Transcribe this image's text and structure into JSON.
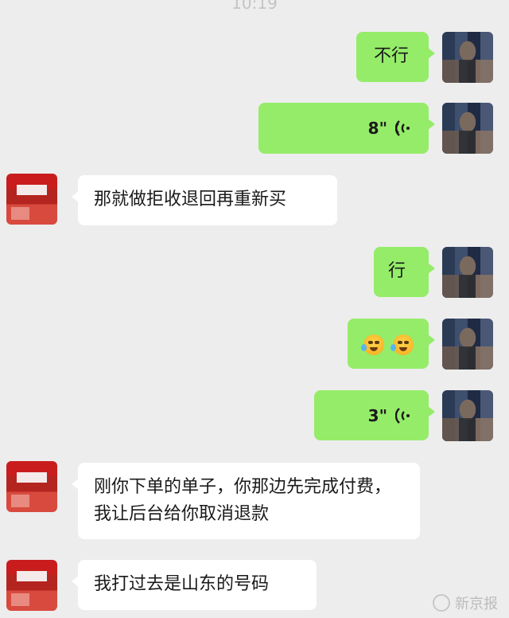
{
  "status_bar": {
    "time": "10:19"
  },
  "messages": [
    {
      "side": "self",
      "type": "text",
      "text": "不行"
    },
    {
      "side": "self",
      "type": "voice",
      "duration": "8\""
    },
    {
      "side": "other",
      "type": "text",
      "text": "那就做拒收退回再重新买"
    },
    {
      "side": "self",
      "type": "text",
      "text": "行"
    },
    {
      "side": "self",
      "type": "emoji",
      "emoji": [
        "cry-laugh-emoji",
        "cry-laugh-emoji"
      ]
    },
    {
      "side": "self",
      "type": "voice",
      "duration": "3\""
    },
    {
      "side": "other",
      "type": "text",
      "text": "刚你下单的单子，你那边先完成付费，我让后台给你取消退款"
    },
    {
      "side": "other",
      "type": "text",
      "text": "我打过去是山东的号码"
    }
  ],
  "watermark": {
    "text": "新京报"
  }
}
